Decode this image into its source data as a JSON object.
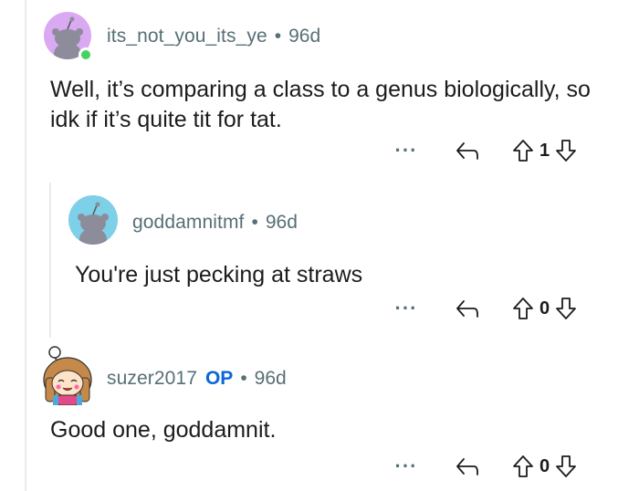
{
  "comments": [
    {
      "username": "its_not_you_its_ye",
      "separator": "•",
      "time": "96d",
      "body": "Well, it’s comparing a class to a genus biologically, so idk if it’s quite tit for tat.",
      "actions": {
        "more": "···",
        "score": "1"
      }
    },
    {
      "username": "goddamnitmf",
      "separator": "•",
      "time": "96d",
      "body": "You're just pecking at straws",
      "actions": {
        "more": "···",
        "score": "0"
      }
    },
    {
      "username": "suzer2017",
      "op_badge": "OP",
      "separator": "•",
      "time": "96d",
      "body": "Good one, goddamnit.",
      "actions": {
        "more": "···",
        "score": "0"
      }
    }
  ],
  "colors": {
    "meta": "#576f76",
    "op": "#0a66d8",
    "online": "#46d160",
    "thread_line": "#e9ebed"
  },
  "icons": [
    "more-options-icon",
    "reply-icon",
    "upvote-icon",
    "downvote-icon",
    "online-status-icon"
  ]
}
